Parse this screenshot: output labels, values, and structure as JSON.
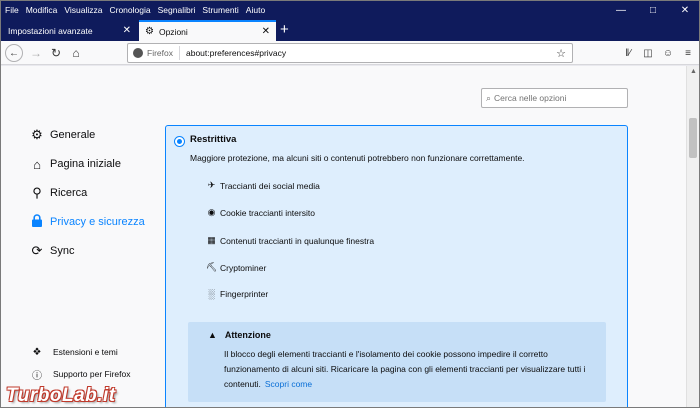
{
  "menubar": {
    "items": [
      "File",
      "Modifica",
      "Visualizza",
      "Cronologia",
      "Segnalibri",
      "Strumenti",
      "Aiuto"
    ]
  },
  "tabs": [
    {
      "label": "Impostazioni avanzate"
    },
    {
      "label": "Opzioni"
    }
  ],
  "navbar": {
    "identity": "Firefox",
    "url": "about:preferences#privacy"
  },
  "search": {
    "placeholder": "Cerca nelle opzioni"
  },
  "sidebar": {
    "categories": [
      {
        "label": "Generale",
        "icon": "gear-icon"
      },
      {
        "label": "Pagina iniziale",
        "icon": "home-icon"
      },
      {
        "label": "Ricerca",
        "icon": "search-icon"
      },
      {
        "label": "Privacy e sicurezza",
        "icon": "lock-icon"
      },
      {
        "label": "Sync",
        "icon": "sync-icon"
      }
    ],
    "footer": [
      {
        "label": "Estensioni e temi",
        "icon": "puzzle-icon"
      },
      {
        "label": "Supporto per Firefox",
        "icon": "help-icon"
      }
    ]
  },
  "panel": {
    "title": "Restrittiva",
    "description": "Maggiore protezione, ma alcuni siti o contenuti potrebbero non funzionare correttamente.",
    "items": [
      "Traccianti dei social media",
      "Cookie traccianti intersito",
      "Contenuti traccianti in qualunque finestra",
      "Cryptominer",
      "Fingerprinter"
    ],
    "warning": {
      "title": "Attenzione",
      "body": "Il blocco degli elementi traccianti e l'isolamento dei cookie possono impedire il corretto funzionamento di alcuni siti. Ricaricare la pagina con gli elementi traccianti per visualizzare tutti i contenuti.",
      "link": "Scopri come"
    }
  },
  "watermark": "TurboLab.it",
  "colors": {
    "accent": "#0a84ff",
    "titlebar": "#0f1b5c",
    "panel": "#deeefd",
    "warning": "#c6dff7"
  }
}
